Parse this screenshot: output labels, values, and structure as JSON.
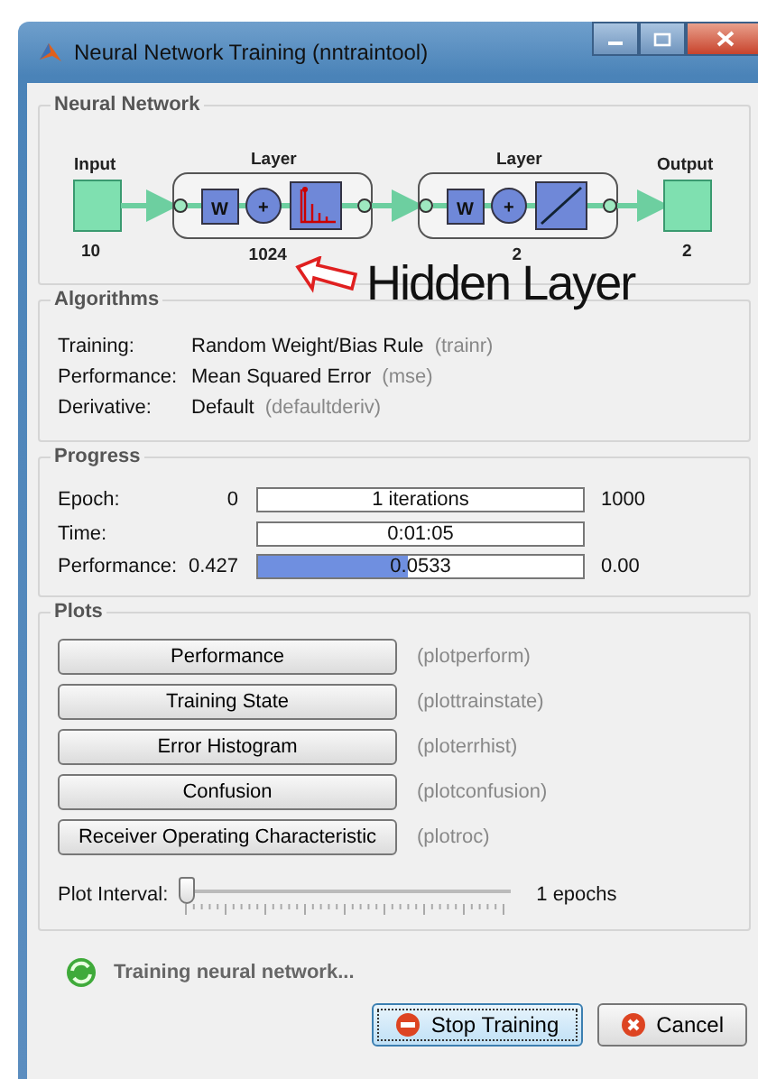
{
  "window": {
    "title": "Neural Network Training (nntraintool)"
  },
  "network": {
    "heading": "Neural Network",
    "input": {
      "label": "Input",
      "size": "10"
    },
    "layers": [
      {
        "label": "Layer",
        "size": "1024",
        "kind": "spike",
        "weight_symbol": "W",
        "sum_symbol": "+"
      },
      {
        "label": "Layer",
        "size": "2",
        "kind": "linear",
        "weight_symbol": "W",
        "sum_symbol": "+"
      }
    ],
    "output": {
      "label": "Output",
      "size": "2"
    }
  },
  "annotation": {
    "text": "Hidden Layer"
  },
  "algorithms": {
    "heading": "Algorithms",
    "rows": [
      {
        "label": "Training:",
        "value": "Random Weight/Bias Rule",
        "code": "(trainr)"
      },
      {
        "label": "Performance:",
        "value": "Mean Squared Error",
        "code": "(mse)"
      },
      {
        "label": "Derivative:",
        "value": "Default",
        "code": "(defaultderiv)"
      }
    ]
  },
  "progress": {
    "heading": "Progress",
    "rows": [
      {
        "label": "Epoch:",
        "start": "0",
        "reading": "1 iterations",
        "end": "1000"
      },
      {
        "label": "Time:",
        "reading": "0:01:05"
      },
      {
        "label": "Performance:",
        "start": "0.427",
        "reading": "0.0533",
        "end": "0.00",
        "level": 0.46
      }
    ]
  },
  "plots": {
    "heading": "Plots",
    "buttons": [
      {
        "label": "Performance",
        "code": "(plotperform)"
      },
      {
        "label": "Training State",
        "code": "(plottrainstate)"
      },
      {
        "label": "Error Histogram",
        "code": "(ploterrhist)"
      },
      {
        "label": "Confusion",
        "code": "(plotconfusion)"
      },
      {
        "label": "Receiver Operating Characteristic",
        "code": "(plotroc)"
      }
    ],
    "interval": {
      "label": "Plot Interval:",
      "level": 0,
      "reading": "1 epochs"
    }
  },
  "status": {
    "text": "Training neural network..."
  },
  "buttons": [
    {
      "label": "Stop Training",
      "kind": "stop",
      "focused": true
    },
    {
      "label": "Cancel",
      "kind": "cancel",
      "focused": false
    }
  ]
}
